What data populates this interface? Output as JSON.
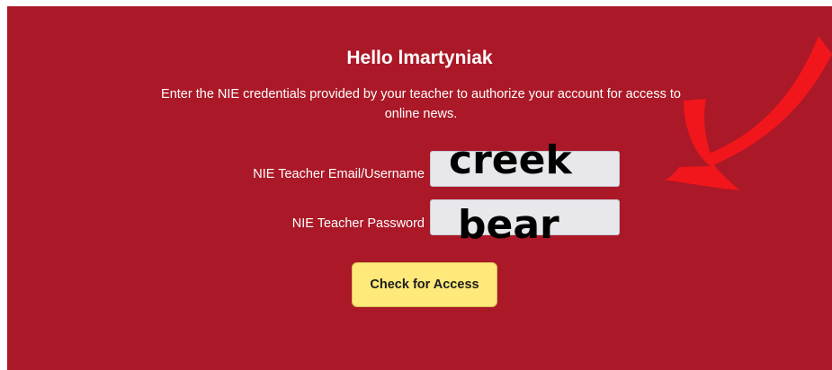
{
  "header": {
    "greeting": "Hello lmartyniak",
    "instructions": "Enter the NIE credentials provided by your teacher to authorize your account for access to online news."
  },
  "form": {
    "email": {
      "label": "NIE Teacher Email/Username",
      "value": "creek"
    },
    "password": {
      "label": "NIE Teacher Password",
      "value": "bear"
    },
    "submit_label": "Check for Access"
  },
  "colors": {
    "panel": "#ab1827",
    "button": "#ffe97a",
    "arrow": "#f0161c"
  },
  "annotation": {
    "icon": "red-arrow-icon"
  }
}
